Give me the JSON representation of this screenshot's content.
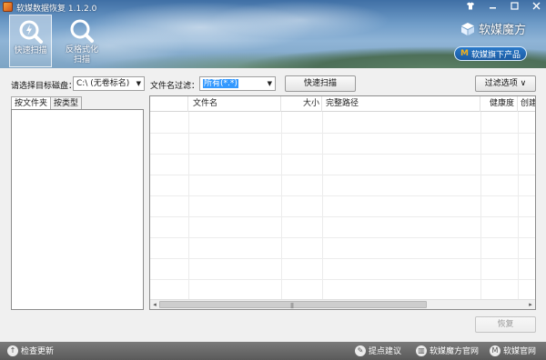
{
  "window": {
    "title": "软媒数据恢复 1.1.2.0"
  },
  "toolbar": {
    "quick_scan_label": "快速扫描",
    "deep_scan_label": "反格式化扫描"
  },
  "brand": {
    "name": "软媒魔方",
    "pill_label": "软媒旗下产品"
  },
  "scan_options": {
    "disk_label": "请选择目标磁盘：",
    "disk_value": "C:\\  (无卷标名)",
    "filter_label": "文件名过滤：",
    "filter_value": "所有(*.*)",
    "scan_button": "快速扫描",
    "filter_options_button": "过滤选项  ∨"
  },
  "left_panel": {
    "tabs": [
      "按文件夹",
      "按类型"
    ]
  },
  "table": {
    "columns": [
      "文件名",
      "大小",
      "完整路径",
      "健康度",
      "创建"
    ],
    "rows": []
  },
  "actions": {
    "recover_button": "恢复"
  },
  "footer": {
    "check_update": "检查更新",
    "suggest": "提点建议",
    "mofang_site": "软媒魔方官网",
    "ruanmei_site": "软媒官网"
  }
}
